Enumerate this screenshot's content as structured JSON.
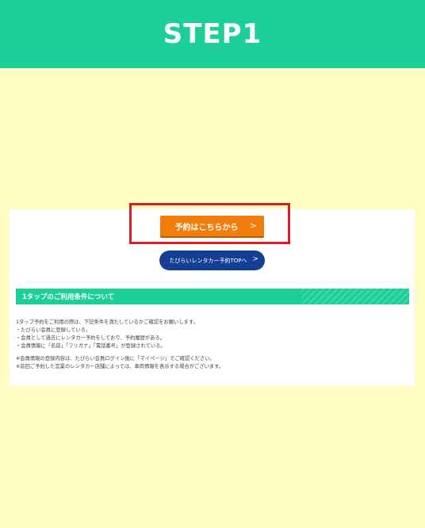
{
  "header": {
    "title": "STEP1"
  },
  "buttons": {
    "reserve_label": "予約はこちらから",
    "reserve_chevron": ">",
    "top_label": "たびらいレンタカー予約TOPへ",
    "top_chevron": ">"
  },
  "section": {
    "title": "1タップのご利用条件について"
  },
  "terms": {
    "intro": "1タップ予約をご利用の際は、下記条件を満たしているかご確認をお願いします。",
    "items": [
      "・たびらい会員に登録している。",
      "・会員として過去にレンタカー予約をしており、予約履歴がある。",
      "・会員情報に「名前」「フリガナ」「電話番号」が登録されている。"
    ],
    "notes": [
      "※会員情報の登録内容は、たびらい会員ログイン後に「マイページ」でご確認ください。",
      "※前回ご予約した営業のレンタカー店舗によっては、車両情報を表示する場合がございます。"
    ]
  },
  "colors": {
    "header_bg": "#1ccf97",
    "page_bg": "#fffdc4",
    "reserve_button": "#f07d0c",
    "top_button": "#143f94",
    "highlight_border": "#d81e1e"
  },
  "icons": [
    "chevron-right-icon"
  ]
}
